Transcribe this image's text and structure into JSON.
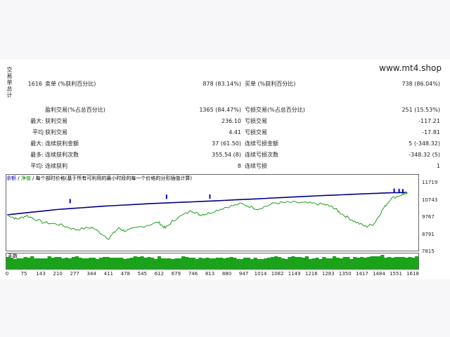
{
  "side_label": "交易单总计",
  "site": "www.mt4.shop",
  "rows": [
    {
      "c1": "",
      "c2": "1616",
      "c3": "卖单 (%获利百分比)",
      "c4": "878 (83.14%)",
      "c5": "买单 (%获利百分比)",
      "c6": "738 (86.04%)"
    },
    {
      "c1": "",
      "c2": "",
      "c3": "盈利交易(%占总百分比)",
      "c4": "1365 (84.47%)",
      "c5": "亏损交易(%占总百分比)",
      "c6": "251 (15.53%)"
    },
    {
      "c1": "最大:",
      "c2": "",
      "c3": "获利交易",
      "c4": "236.10",
      "c5": "亏损交易",
      "c6": "-117.21"
    },
    {
      "c1": "平均",
      "c2": "",
      "c3": "获利交易",
      "c4": "4.41",
      "c5": "亏损交易",
      "c6": "-17.81"
    },
    {
      "c1": "最大:",
      "c2": "",
      "c3": "连续获利金额",
      "c4": "37 (61.50)",
      "c5": "连续亏损金额",
      "c6": "5 (-348.32)"
    },
    {
      "c1": "最多:",
      "c2": "",
      "c3": "连续获利次数",
      "c4": "355.54 (8)",
      "c5": "连续亏损次数",
      "c6": "-348.32 (5)"
    },
    {
      "c1": "平均:",
      "c2": "",
      "c3": "连续获利",
      "c4": "8",
      "c5": "连续亏损",
      "c6": "1"
    }
  ],
  "chart_header": {
    "balance": "余额",
    "sep1": " / ",
    "equity": "净值",
    "sep2": " / ",
    "note": "每个部时价格(基于所有可利用的最小时段的每一个价格的分形插值计算)"
  },
  "volume_label": "手数",
  "colors": {
    "balance": "#00008b",
    "equity": "#1f9e1f",
    "volume": "#1aa31a",
    "marker": "#0000c0"
  },
  "chart_data": {
    "type": "line",
    "x_ticks": [
      "0",
      "75",
      "143",
      "210",
      "277",
      "344",
      "411",
      "478",
      "545",
      "612",
      "679",
      "746",
      "813",
      "880",
      "947",
      "1014",
      "1082",
      "1149",
      "1216",
      "1283",
      "1350",
      "1417",
      "1484",
      "1551",
      "1618"
    ],
    "y_ticks": [
      "11719",
      "10743",
      "9767",
      "8791",
      "7815"
    ],
    "ylim": [
      7815,
      12300
    ],
    "xlim": [
      0,
      1660
    ],
    "series": [
      {
        "name": "余额",
        "points": [
          [
            0,
            10200
          ],
          [
            200,
            10560
          ],
          [
            400,
            10800
          ],
          [
            600,
            10980
          ],
          [
            800,
            11120
          ],
          [
            1000,
            11280
          ],
          [
            1200,
            11450
          ],
          [
            1400,
            11600
          ],
          [
            1550,
            11700
          ],
          [
            1618,
            11719
          ]
        ]
      },
      {
        "name": "净值",
        "points": [
          [
            0,
            10220
          ],
          [
            40,
            9900
          ],
          [
            80,
            10150
          ],
          [
            143,
            9700
          ],
          [
            210,
            9550
          ],
          [
            277,
            9200
          ],
          [
            344,
            9350
          ],
          [
            411,
            8600
          ],
          [
            450,
            9300
          ],
          [
            478,
            9100
          ],
          [
            545,
            9400
          ],
          [
            612,
            9700
          ],
          [
            640,
            9300
          ],
          [
            679,
            9900
          ],
          [
            746,
            10500
          ],
          [
            780,
            10200
          ],
          [
            813,
            10300
          ],
          [
            880,
            10700
          ],
          [
            947,
            10950
          ],
          [
            1014,
            10600
          ],
          [
            1082,
            11000
          ],
          [
            1149,
            11050
          ],
          [
            1216,
            11000
          ],
          [
            1283,
            10900
          ],
          [
            1320,
            10700
          ],
          [
            1350,
            10300
          ],
          [
            1400,
            9800
          ],
          [
            1450,
            9400
          ],
          [
            1484,
            9600
          ],
          [
            1520,
            10600
          ],
          [
            1551,
            11300
          ],
          [
            1600,
            11600
          ],
          [
            1618,
            11650
          ]
        ]
      }
    ]
  }
}
